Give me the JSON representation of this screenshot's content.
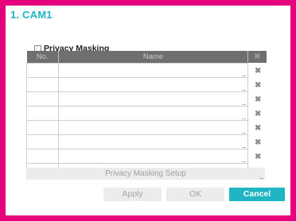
{
  "dialog": {
    "title": "1. CAM1",
    "privacy_masking_label": "Privacy Masking",
    "privacy_masking_checked": false
  },
  "table": {
    "headers": {
      "no": "No.",
      "name": "Name",
      "delete_icon": "✖"
    },
    "rows": [
      {
        "no": "",
        "name": ""
      },
      {
        "no": "",
        "name": ""
      },
      {
        "no": "",
        "name": ""
      },
      {
        "no": "",
        "name": ""
      },
      {
        "no": "",
        "name": ""
      },
      {
        "no": "",
        "name": ""
      },
      {
        "no": "",
        "name": ""
      },
      {
        "no": "",
        "name": ""
      }
    ],
    "row_delete_icon": "✖",
    "edit_marker": "_"
  },
  "buttons": {
    "setup": "Privacy Masking Setup",
    "apply": "Apply",
    "ok": "OK",
    "cancel": "Cancel"
  },
  "colors": {
    "frame": "#e6007e",
    "accent": "#1fb5c4",
    "header_bg": "#6f6f6f",
    "disabled_bg": "#ececec"
  },
  "icons": {
    "delete": "close-x-icon",
    "checkbox": "checkbox-icon"
  }
}
